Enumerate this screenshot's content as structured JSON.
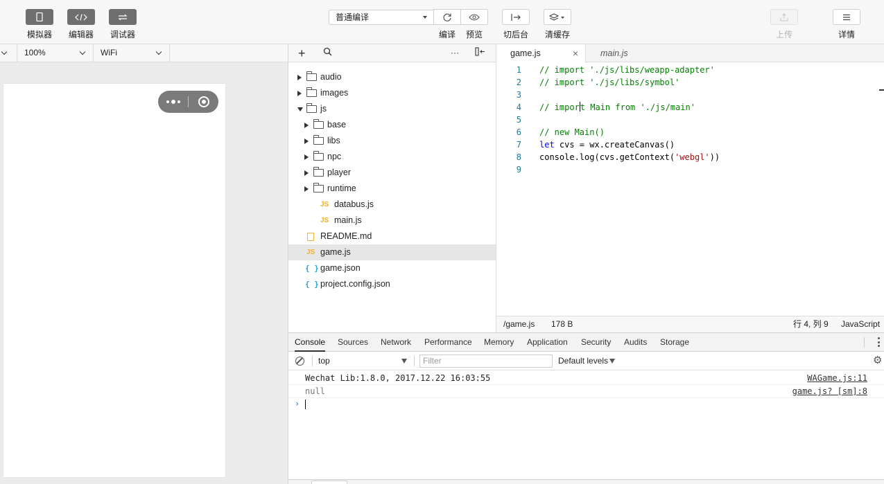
{
  "toolbar": {
    "simulator": "模拟器",
    "editor": "编辑器",
    "debugger": "调试器",
    "compile_mode": "普通编译",
    "compile": "编译",
    "preview": "预览",
    "background": "切后台",
    "clear_cache": "清缓存",
    "upload": "上传",
    "details": "详情"
  },
  "simulator": {
    "zoom": "100%",
    "network": "WiFi"
  },
  "tree": {
    "items": [
      {
        "name": "audio",
        "kind": "folder"
      },
      {
        "name": "images",
        "kind": "folder"
      },
      {
        "name": "js",
        "kind": "folder-open"
      },
      {
        "name": "base",
        "kind": "folder"
      },
      {
        "name": "libs",
        "kind": "folder"
      },
      {
        "name": "npc",
        "kind": "folder"
      },
      {
        "name": "player",
        "kind": "folder"
      },
      {
        "name": "runtime",
        "kind": "folder"
      },
      {
        "name": "databus.js",
        "kind": "js"
      },
      {
        "name": "main.js",
        "kind": "js"
      },
      {
        "name": "README.md",
        "kind": "md"
      },
      {
        "name": "game.js",
        "kind": "js"
      },
      {
        "name": "game.json",
        "kind": "json"
      },
      {
        "name": "project.config.json",
        "kind": "json"
      }
    ],
    "js_badge": "JS",
    "json_badge": "{ }"
  },
  "editor": {
    "tabs": [
      "game.js",
      "main.js"
    ],
    "close_glyph": "×",
    "line_numbers": [
      "1",
      "2",
      "3",
      "4",
      "5",
      "6",
      "7",
      "8",
      "9"
    ],
    "code": {
      "l1": "// import './js/libs/weapp-adapter'",
      "l2": "// import './js/libs/symbol'",
      "l4a": "// impor",
      "l4b": "t Main from './js/main'",
      "l6": "// new Main()",
      "l7kw": "let",
      "l7": " cvs = wx.createCanvas()",
      "l8a": "console.log(cvs.getContext(",
      "l8s": "'webgl'",
      "l8b": "))"
    },
    "status": {
      "path": "/game.js",
      "size": "178 B",
      "position": "行 4, 列 9",
      "language": "JavaScript"
    }
  },
  "devtools": {
    "tabs": [
      "Console",
      "Sources",
      "Network",
      "Performance",
      "Memory",
      "Application",
      "Security",
      "Audits",
      "Storage"
    ],
    "context": "top",
    "filter_placeholder": "Filter",
    "levels": "Default levels",
    "logs": [
      {
        "message": "Wechat Lib:1.8.0, 2017.12.22 16:03:55",
        "source": "WAGame.js:11"
      },
      {
        "message": "null",
        "source": "game.js? [sm]:8"
      }
    ],
    "prompt": "›"
  }
}
